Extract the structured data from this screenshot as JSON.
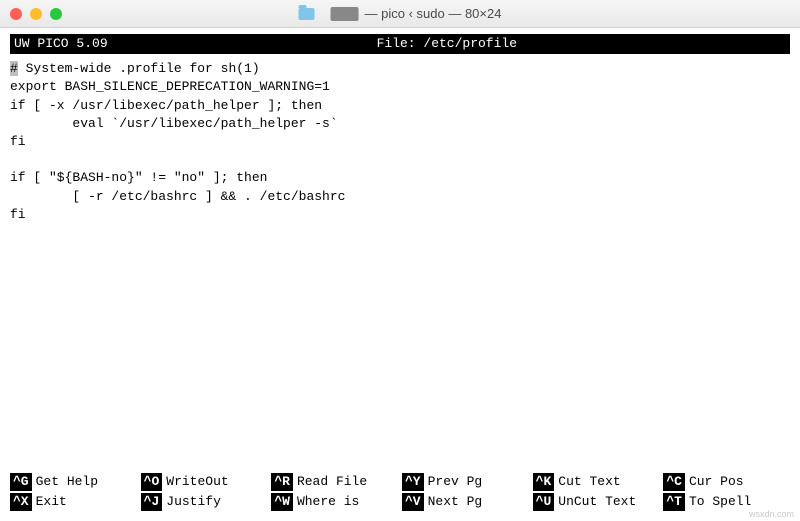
{
  "window": {
    "title": "— pico ‹ sudo — 80×24"
  },
  "status": {
    "app": "UW PICO 5.09",
    "file_label": "File: /etc/profile"
  },
  "editor": {
    "cursor_char": "#",
    "line1_rest": " System-wide .profile for sh(1)",
    "line2": "export BASH_SILENCE_DEPRECATION_WARNING=1",
    "line3": "if [ -x /usr/libexec/path_helper ]; then",
    "line4": "        eval `/usr/libexec/path_helper -s`",
    "line5": "fi",
    "line6": "",
    "line7": "if [ \"${BASH-no}\" != \"no\" ]; then",
    "line8": "        [ -r /etc/bashrc ] && . /etc/bashrc",
    "line9": "fi"
  },
  "shortcuts": [
    {
      "key": "^G",
      "label": "Get Help"
    },
    {
      "key": "^O",
      "label": "WriteOut"
    },
    {
      "key": "^R",
      "label": "Read File"
    },
    {
      "key": "^Y",
      "label": "Prev Pg"
    },
    {
      "key": "^K",
      "label": "Cut Text"
    },
    {
      "key": "^C",
      "label": "Cur Pos"
    },
    {
      "key": "^X",
      "label": "Exit"
    },
    {
      "key": "^J",
      "label": "Justify"
    },
    {
      "key": "^W",
      "label": "Where is"
    },
    {
      "key": "^V",
      "label": "Next Pg"
    },
    {
      "key": "^U",
      "label": "UnCut Text"
    },
    {
      "key": "^T",
      "label": "To Spell"
    }
  ],
  "watermark": "wsxdn.com"
}
